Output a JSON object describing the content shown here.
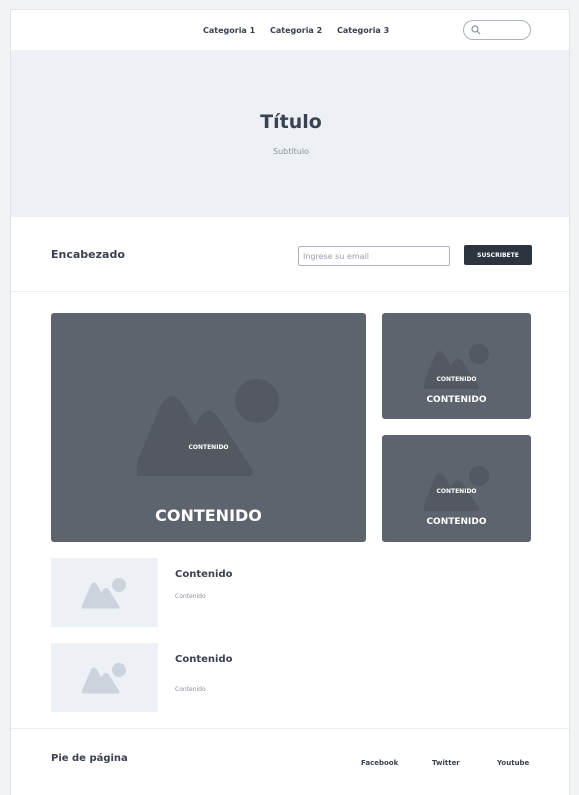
{
  "nav": {
    "links": [
      "Categoria 1",
      "Categoria 2",
      "Categoria 3"
    ],
    "search_icon": "search-icon"
  },
  "hero": {
    "title": "Título",
    "subtitle": "Subtítulo"
  },
  "subscribe": {
    "heading": "Encabezado",
    "email_placeholder": "Ingrese su email",
    "button_label": "SUSCRIBETE"
  },
  "featured": {
    "main": {
      "inner_label": "CONTENIDO",
      "caption": "CONTENIDO"
    },
    "side": [
      {
        "inner_label": "CONTENIDO",
        "caption": "CONTENIDO"
      },
      {
        "inner_label": "CONTENIDO",
        "caption": "CONTENIDO"
      }
    ]
  },
  "list": [
    {
      "title": "Contenido",
      "text": "Contenido"
    },
    {
      "title": "Contenido",
      "text": "Contenido"
    }
  ],
  "footer": {
    "heading": "Pie de página",
    "links": [
      "Facebook",
      "Twitter",
      "Youtube"
    ]
  },
  "colors": {
    "hero_bg": "#edf0f4",
    "card_bg": "#5e646d",
    "button_bg": "#2c3440",
    "text": "#3a4150"
  }
}
